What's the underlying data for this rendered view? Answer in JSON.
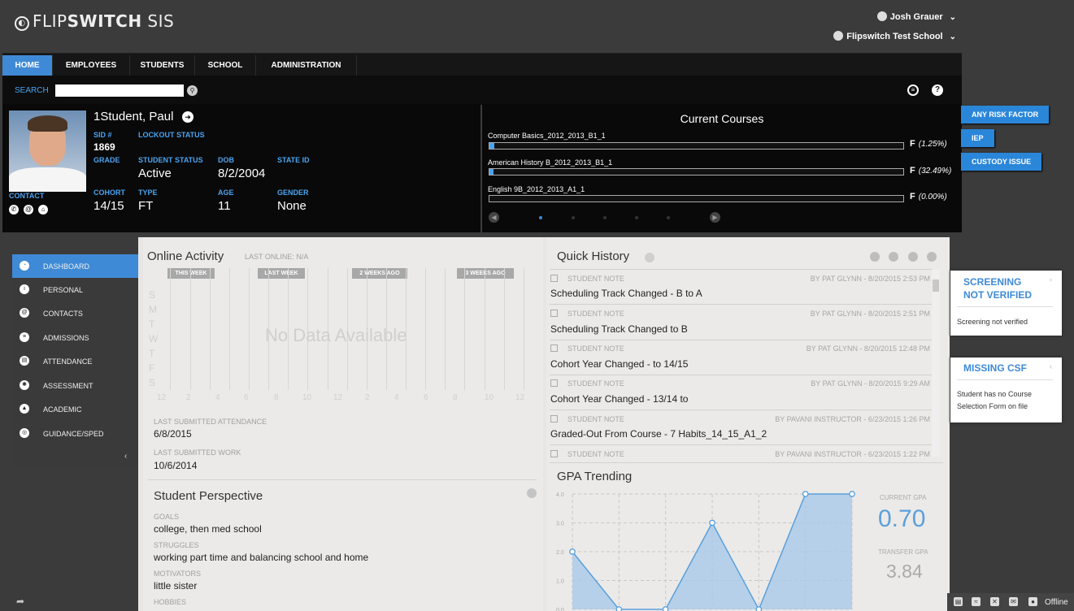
{
  "app": {
    "logo_text_light": "FLIP",
    "logo_text_bold": "SWITCH",
    "logo_suffix": " SIS"
  },
  "user": {
    "name": "Josh Grauer",
    "school": "Flipswitch Test School"
  },
  "nav": {
    "tabs": [
      "HOME",
      "EMPLOYEES",
      "STUDENTS",
      "SCHOOL",
      "ADMINISTRATION"
    ],
    "active": "HOME"
  },
  "search": {
    "label": "SEARCH",
    "value": ""
  },
  "student": {
    "name": "1Student, Paul",
    "sid_label": "SID #",
    "sid": "1869",
    "lockout_label": "LOCKOUT STATUS",
    "grade_label": "GRADE",
    "status_label": "STUDENT STATUS",
    "status": "Active",
    "dob_label": "DOB",
    "dob": "8/2/2004",
    "stateid_label": "STATE ID",
    "contact_label": "CONTACT",
    "cohort_label": "COHORT",
    "cohort": "14/15",
    "type_label": "TYPE",
    "type": "FT",
    "age_label": "AGE",
    "age": "11",
    "gender_label": "GENDER",
    "gender": "None"
  },
  "courses": {
    "title": "Current Courses",
    "items": [
      {
        "name": "Computer Basics_2012_2013_B1_1",
        "letter": "F",
        "pct": "(1.25%)",
        "progress": 0.0125
      },
      {
        "name": "American History B_2012_2013_B1_1",
        "letter": "F",
        "pct": "(32.49%)",
        "progress": 0.01
      },
      {
        "name": "English 9B_2012_2013_A1_1",
        "letter": "F",
        "pct": "(0.00%)",
        "progress": 0.0
      }
    ]
  },
  "risk_flags": [
    "ANY RISK FACTOR",
    "IEP",
    "CUSTODY ISSUE"
  ],
  "sidebar": {
    "items": [
      {
        "label": "DASHBOARD",
        "icon": "dashboard-icon"
      },
      {
        "label": "PERSONAL",
        "icon": "info-icon"
      },
      {
        "label": "CONTACTS",
        "icon": "at-icon"
      },
      {
        "label": "ADMISSIONS",
        "icon": "admissions-icon"
      },
      {
        "label": "ATTENDANCE",
        "icon": "attendance-icon"
      },
      {
        "label": "ASSESSMENT",
        "icon": "assessment-icon"
      },
      {
        "label": "ACADEMIC",
        "icon": "academic-icon"
      },
      {
        "label": "GUIDANCE/SPED",
        "icon": "guidance-icon"
      }
    ],
    "active": "DASHBOARD"
  },
  "online_activity": {
    "title": "Online Activity",
    "last_online": "LAST ONLINE: N/A",
    "weeks": [
      "THIS WEEK",
      "LAST WEEK",
      "2 WEEKS AGO",
      "3 WEEKS AGO"
    ],
    "days": [
      "S",
      "M",
      "T",
      "W",
      "T",
      "F",
      "S"
    ],
    "ticks": [
      "12",
      "2",
      "4",
      "6",
      "8",
      "10",
      "12",
      "2",
      "4",
      "6",
      "8",
      "10",
      "12"
    ],
    "no_data": "No Data Available",
    "last_attendance_label": "LAST SUBMITTED ATTENDANCE",
    "last_attendance": "6/8/2015",
    "last_work_label": "LAST SUBMITTED WORK",
    "last_work": "10/6/2014"
  },
  "perspective": {
    "title": "Student Perspective",
    "goals_label": "GOALS",
    "goals": "college, then med school",
    "struggles_label": "STRUGGLES",
    "struggles": "working part time and balancing school and home",
    "motivators_label": "MOTIVATORS",
    "motivators": "little sister",
    "hobbies_label": "HOBBIES"
  },
  "quick_history": {
    "title": "Quick History",
    "entries": [
      {
        "type": "STUDENT NOTE",
        "by": "BY PAT GLYNN - 8/20/2015 2:53 PM",
        "title": "Scheduling Track Changed - B to A"
      },
      {
        "type": "STUDENT NOTE",
        "by": "BY PAT GLYNN - 8/20/2015 2:51 PM",
        "title": "Scheduling Track Changed to B"
      },
      {
        "type": "STUDENT NOTE",
        "by": "BY PAT GLYNN - 8/20/2015 12:48 PM",
        "title": "Cohort Year Changed - to 14/15"
      },
      {
        "type": "STUDENT NOTE",
        "by": "BY PAT GLYNN - 8/20/2015 9:29 AM",
        "title": "Cohort Year Changed - 13/14 to"
      },
      {
        "type": "STUDENT NOTE",
        "by": "BY PAVANI INSTRUCTOR - 6/23/2015 1:26 PM",
        "title": "Graded-Out From Course - 7 Habits_14_15_A1_2"
      },
      {
        "type": "STUDENT NOTE",
        "by": "BY PAVANI INSTRUCTOR - 6/23/2015 1:22 PM",
        "title": ""
      }
    ]
  },
  "gpa": {
    "title": "GPA Trending",
    "current_label": "CURRENT GPA",
    "current": "0.70",
    "transfer_label": "TRANSFER GPA",
    "transfer": "3.84"
  },
  "chart_data": {
    "type": "area",
    "title": "GPA Trending",
    "y_ticks": [
      "4.0",
      "3.0",
      "2.0",
      "1.0",
      "0.0"
    ],
    "ylim": [
      0,
      4
    ],
    "values": [
      2.0,
      0.0,
      0.0,
      3.0,
      0.0,
      4.0,
      4.0
    ],
    "grid": true
  },
  "alerts": [
    {
      "title_line1": "SCREENING",
      "title_line2": "NOT VERIFIED",
      "body": "Screening not verified"
    },
    {
      "title_line1": "MISSING CSF",
      "body_line1": "Student has no Course",
      "body_line2": "Selection Form on file"
    }
  ],
  "status": {
    "text": "Offline"
  },
  "colors": {
    "accent": "#3f8ad6",
    "label_blue": "#4aa3f0",
    "gpa_fill": "#a9c9e8",
    "gpa_line": "#5aa0dc"
  }
}
